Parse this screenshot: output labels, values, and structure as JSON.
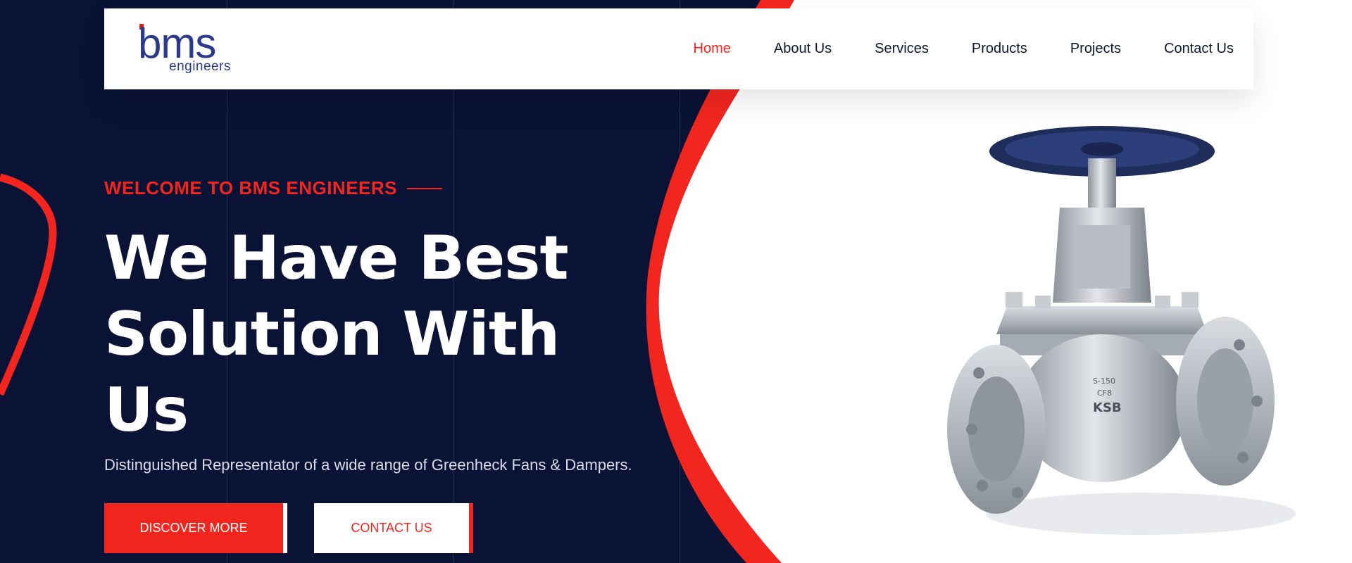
{
  "header": {
    "logo": {
      "main": "bms",
      "sub": "engineers"
    },
    "nav": [
      "Home",
      "About Us",
      "Services",
      "Products",
      "Projects",
      "Contact Us"
    ],
    "active_nav": "Home"
  },
  "hero": {
    "eyebrow": "WELCOME TO BMS ENGINEERS",
    "headline": "We Have Best Solution With Us",
    "subtitle": "Distinguished Representator of a wide range of Greenheck Fans & Dampers.",
    "primary_button": "DISCOVER MORE",
    "secondary_button": "CONTACT US"
  },
  "product_image": {
    "markings": [
      "S-150",
      "CF8",
      "KSB"
    ]
  },
  "colors": {
    "navy": "#0a1235",
    "accent_red": "#f2261f",
    "white": "#ffffff",
    "logo_blue": "#2b3a8c"
  }
}
